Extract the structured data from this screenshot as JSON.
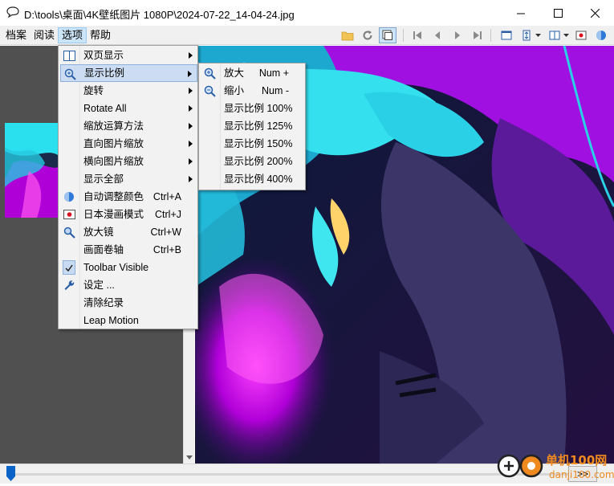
{
  "window": {
    "title": "D:\\tools\\桌面\\4K壁纸图片 1080P\\2024-07-22_14-04-24.jpg",
    "minimize": "—",
    "maximize": "☐",
    "close": "✕"
  },
  "menubar": {
    "items": [
      "档案",
      "阅读",
      "选项",
      "帮助"
    ],
    "active_index": 2
  },
  "options_menu": {
    "items": [
      {
        "label": "双页显示",
        "shortcut": "",
        "submenu": true,
        "icon": "two-page-icon"
      },
      {
        "label": "显示比例",
        "shortcut": "",
        "submenu": true,
        "icon": "zoom-icon",
        "highlighted": true
      },
      {
        "label": "旋转",
        "shortcut": "",
        "submenu": true,
        "icon": ""
      },
      {
        "label": "Rotate All",
        "shortcut": "",
        "submenu": true,
        "icon": ""
      },
      {
        "label": "缩放运算方法",
        "shortcut": "",
        "submenu": true,
        "icon": ""
      },
      {
        "label": "直向图片缩放",
        "shortcut": "",
        "submenu": true,
        "icon": ""
      },
      {
        "label": "横向图片缩放",
        "shortcut": "",
        "submenu": true,
        "icon": ""
      },
      {
        "label": "显示全部",
        "shortcut": "",
        "submenu": true,
        "icon": ""
      },
      {
        "label": "自动调整颜色",
        "shortcut": "Ctrl+A",
        "submenu": false,
        "icon": "auto-color-icon"
      },
      {
        "label": "日本漫画模式",
        "shortcut": "Ctrl+J",
        "submenu": false,
        "icon": "manga-mode-icon"
      },
      {
        "label": "放大镜",
        "shortcut": "Ctrl+W",
        "submenu": false,
        "icon": "magnifier-icon"
      },
      {
        "label": "画面卷轴",
        "shortcut": "Ctrl+B",
        "submenu": false,
        "icon": ""
      },
      {
        "label": "Toolbar Visible",
        "shortcut": "",
        "submenu": false,
        "icon": "checkmark-icon",
        "checked": true
      },
      {
        "label": "设定 ...",
        "shortcut": "",
        "submenu": false,
        "icon": "wrench-icon"
      },
      {
        "label": "清除纪录",
        "shortcut": "",
        "submenu": false,
        "icon": ""
      },
      {
        "label": "Leap Motion",
        "shortcut": "",
        "submenu": false,
        "icon": ""
      }
    ]
  },
  "zoom_submenu": {
    "items": [
      {
        "label": "放大",
        "shortcut": "Num +",
        "icon": "zoom-in-icon"
      },
      {
        "label": "缩小",
        "shortcut": "Num -",
        "icon": "zoom-out-icon"
      },
      {
        "label": "显示比例 100%",
        "shortcut": ""
      },
      {
        "label": "显示比例 125%",
        "shortcut": ""
      },
      {
        "label": "显示比例 150%",
        "shortcut": ""
      },
      {
        "label": "显示比例 200%",
        "shortcut": ""
      },
      {
        "label": "显示比例 400%",
        "shortcut": ""
      }
    ]
  },
  "bottom": {
    "nav_label": ">>",
    "progress": 0.0
  },
  "colors": {
    "accent": "#0a64c8",
    "menu_highlight": "#cbdcf3",
    "image_purple": "#b000d8",
    "image_cyan": "#35e0ee"
  }
}
